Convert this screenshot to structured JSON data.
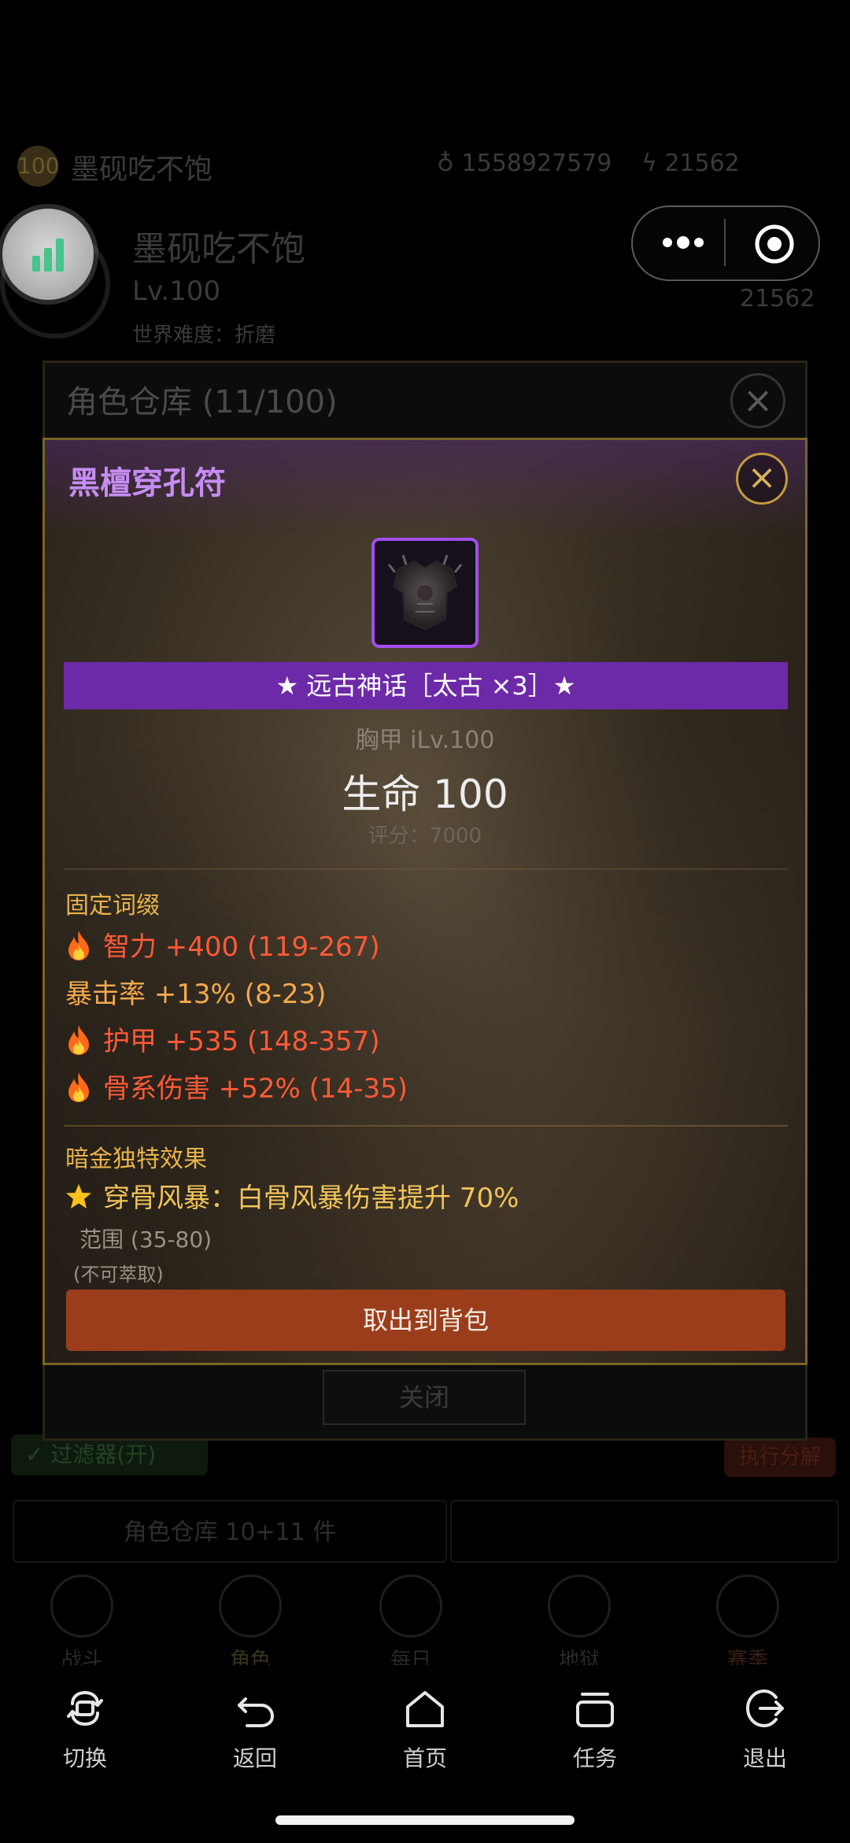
{
  "background": {
    "level_badge": "100",
    "player_name": "墨砚吃不饱",
    "gold": "1558927579",
    "energy": "21562",
    "level_text": "Lv.100",
    "difficulty": "世界难度：折磨",
    "energy_right": "21562",
    "filter_label": "过滤器(开)",
    "decompose_label": "执行分解",
    "warehouse_button": "角色仓库 10+11 件",
    "nav": [
      "战斗",
      "角色",
      "每日",
      "地狱",
      "赛季"
    ]
  },
  "warehouse": {
    "title": "角色仓库 (11/100)",
    "close_label": "关闭"
  },
  "item": {
    "name": "黑檀穿孔符",
    "rarity": "★ 远古神话［太古 ×3］★",
    "slot_line": "胸甲  iLv.100",
    "main_stat": "生命  100",
    "score": "评分：7000",
    "fixed_affix_title": "固定词缀",
    "affixes": [
      {
        "text": "智力 +400 (119-267)",
        "fire": true,
        "color": "red"
      },
      {
        "text": "暴击率 +13% (8-23)",
        "fire": false,
        "color": "orange"
      },
      {
        "text": "护甲 +535 (148-357)",
        "fire": true,
        "color": "red"
      },
      {
        "text": "骨系伤害 +52% (14-35)",
        "fire": true,
        "color": "red"
      }
    ],
    "unique_title": "暗金独特效果",
    "unique_effect": "穿骨风暴：白骨风暴伤害提升 70%",
    "range": "范围 (35-80)",
    "non_extractable": "(不可萃取)",
    "take_out_button": "取出到背包"
  },
  "system_bar": {
    "items": [
      {
        "label": "切换",
        "icon": "switch-icon"
      },
      {
        "label": "返回",
        "icon": "back-icon"
      },
      {
        "label": "首页",
        "icon": "home-icon"
      },
      {
        "label": "任务",
        "icon": "tasks-icon"
      },
      {
        "label": "退出",
        "icon": "exit-icon"
      }
    ]
  },
  "colors": {
    "rarity_purple": "#6d2aa8",
    "item_name": "#c58cf2",
    "affix_red": "#ff5a38",
    "section_gold": "#e7b34b",
    "button_rust": "#9b3d1a"
  }
}
